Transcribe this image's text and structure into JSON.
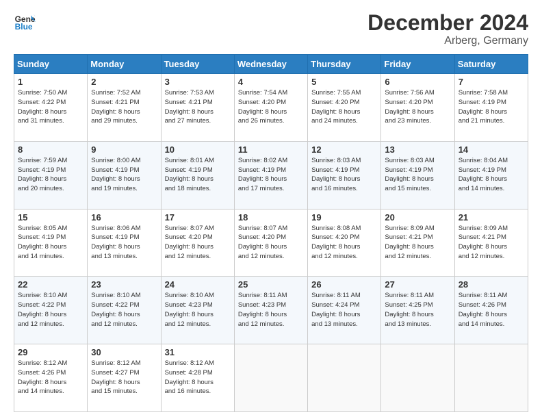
{
  "logo": {
    "line1": "General",
    "line2": "Blue"
  },
  "title": "December 2024",
  "subtitle": "Arberg, Germany",
  "header_days": [
    "Sunday",
    "Monday",
    "Tuesday",
    "Wednesday",
    "Thursday",
    "Friday",
    "Saturday"
  ],
  "weeks": [
    [
      {
        "day": "1",
        "sunrise": "7:50 AM",
        "sunset": "4:22 PM",
        "daylight": "8 hours and 31 minutes."
      },
      {
        "day": "2",
        "sunrise": "7:52 AM",
        "sunset": "4:21 PM",
        "daylight": "8 hours and 29 minutes."
      },
      {
        "day": "3",
        "sunrise": "7:53 AM",
        "sunset": "4:21 PM",
        "daylight": "8 hours and 27 minutes."
      },
      {
        "day": "4",
        "sunrise": "7:54 AM",
        "sunset": "4:20 PM",
        "daylight": "8 hours and 26 minutes."
      },
      {
        "day": "5",
        "sunrise": "7:55 AM",
        "sunset": "4:20 PM",
        "daylight": "8 hours and 24 minutes."
      },
      {
        "day": "6",
        "sunrise": "7:56 AM",
        "sunset": "4:20 PM",
        "daylight": "8 hours and 23 minutes."
      },
      {
        "day": "7",
        "sunrise": "7:58 AM",
        "sunset": "4:19 PM",
        "daylight": "8 hours and 21 minutes."
      }
    ],
    [
      {
        "day": "8",
        "sunrise": "7:59 AM",
        "sunset": "4:19 PM",
        "daylight": "8 hours and 20 minutes."
      },
      {
        "day": "9",
        "sunrise": "8:00 AM",
        "sunset": "4:19 PM",
        "daylight": "8 hours and 19 minutes."
      },
      {
        "day": "10",
        "sunrise": "8:01 AM",
        "sunset": "4:19 PM",
        "daylight": "8 hours and 18 minutes."
      },
      {
        "day": "11",
        "sunrise": "8:02 AM",
        "sunset": "4:19 PM",
        "daylight": "8 hours and 17 minutes."
      },
      {
        "day": "12",
        "sunrise": "8:03 AM",
        "sunset": "4:19 PM",
        "daylight": "8 hours and 16 minutes."
      },
      {
        "day": "13",
        "sunrise": "8:03 AM",
        "sunset": "4:19 PM",
        "daylight": "8 hours and 15 minutes."
      },
      {
        "day": "14",
        "sunrise": "8:04 AM",
        "sunset": "4:19 PM",
        "daylight": "8 hours and 14 minutes."
      }
    ],
    [
      {
        "day": "15",
        "sunrise": "8:05 AM",
        "sunset": "4:19 PM",
        "daylight": "8 hours and 14 minutes."
      },
      {
        "day": "16",
        "sunrise": "8:06 AM",
        "sunset": "4:19 PM",
        "daylight": "8 hours and 13 minutes."
      },
      {
        "day": "17",
        "sunrise": "8:07 AM",
        "sunset": "4:20 PM",
        "daylight": "8 hours and 12 minutes."
      },
      {
        "day": "18",
        "sunrise": "8:07 AM",
        "sunset": "4:20 PM",
        "daylight": "8 hours and 12 minutes."
      },
      {
        "day": "19",
        "sunrise": "8:08 AM",
        "sunset": "4:20 PM",
        "daylight": "8 hours and 12 minutes."
      },
      {
        "day": "20",
        "sunrise": "8:09 AM",
        "sunset": "4:21 PM",
        "daylight": "8 hours and 12 minutes."
      },
      {
        "day": "21",
        "sunrise": "8:09 AM",
        "sunset": "4:21 PM",
        "daylight": "8 hours and 12 minutes."
      }
    ],
    [
      {
        "day": "22",
        "sunrise": "8:10 AM",
        "sunset": "4:22 PM",
        "daylight": "8 hours and 12 minutes."
      },
      {
        "day": "23",
        "sunrise": "8:10 AM",
        "sunset": "4:22 PM",
        "daylight": "8 hours and 12 minutes."
      },
      {
        "day": "24",
        "sunrise": "8:10 AM",
        "sunset": "4:23 PM",
        "daylight": "8 hours and 12 minutes."
      },
      {
        "day": "25",
        "sunrise": "8:11 AM",
        "sunset": "4:23 PM",
        "daylight": "8 hours and 12 minutes."
      },
      {
        "day": "26",
        "sunrise": "8:11 AM",
        "sunset": "4:24 PM",
        "daylight": "8 hours and 13 minutes."
      },
      {
        "day": "27",
        "sunrise": "8:11 AM",
        "sunset": "4:25 PM",
        "daylight": "8 hours and 13 minutes."
      },
      {
        "day": "28",
        "sunrise": "8:11 AM",
        "sunset": "4:26 PM",
        "daylight": "8 hours and 14 minutes."
      }
    ],
    [
      {
        "day": "29",
        "sunrise": "8:12 AM",
        "sunset": "4:26 PM",
        "daylight": "8 hours and 14 minutes."
      },
      {
        "day": "30",
        "sunrise": "8:12 AM",
        "sunset": "4:27 PM",
        "daylight": "8 hours and 15 minutes."
      },
      {
        "day": "31",
        "sunrise": "8:12 AM",
        "sunset": "4:28 PM",
        "daylight": "8 hours and 16 minutes."
      },
      null,
      null,
      null,
      null
    ]
  ],
  "labels": {
    "sunrise": "Sunrise:",
    "sunset": "Sunset:",
    "daylight": "Daylight:"
  }
}
